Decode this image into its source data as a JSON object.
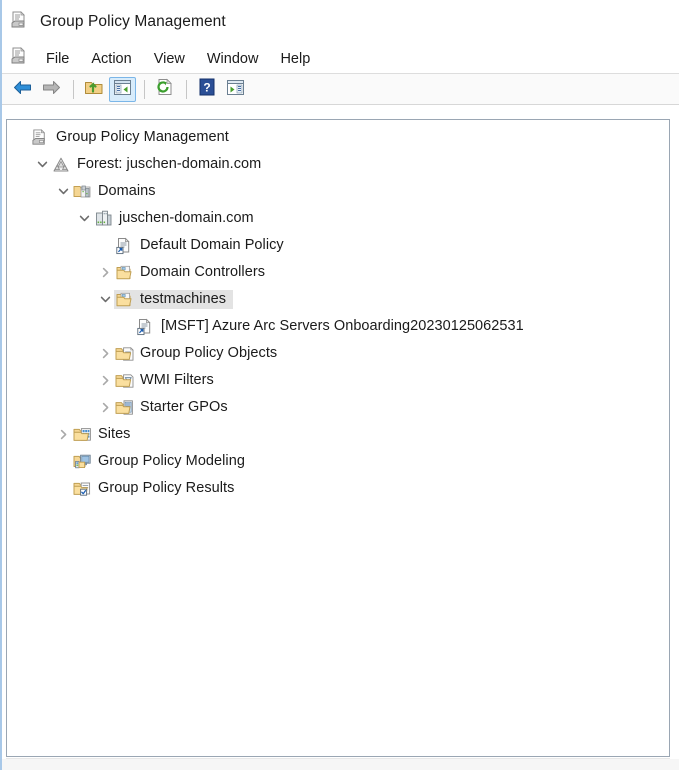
{
  "window": {
    "title": "Group Policy Management",
    "title_icon": "gpmc-console-icon"
  },
  "menubar": {
    "icon": "gpmc-console-icon",
    "items": [
      {
        "label": "File",
        "name": "menu-file"
      },
      {
        "label": "Action",
        "name": "menu-action"
      },
      {
        "label": "View",
        "name": "menu-view"
      },
      {
        "label": "Window",
        "name": "menu-window"
      },
      {
        "label": "Help",
        "name": "menu-help"
      }
    ]
  },
  "toolbar": {
    "buttons": [
      {
        "name": "back-button",
        "icon": "back-arrow-icon",
        "active": false
      },
      {
        "name": "forward-button",
        "icon": "forward-arrow-icon",
        "active": false
      },
      {
        "name": "up-one-level-button",
        "icon": "up-folder-icon",
        "active": false
      },
      {
        "name": "show-hide-console-tree-button",
        "icon": "console-tree-icon",
        "active": true
      },
      {
        "name": "refresh-button",
        "icon": "refresh-icon",
        "active": false
      },
      {
        "name": "help-button",
        "icon": "question-mark-icon",
        "active": false
      },
      {
        "name": "show-hide-action-pane-button",
        "icon": "action-pane-icon",
        "active": false
      }
    ]
  },
  "tree": {
    "nodes": [
      {
        "label": "Group Policy Management",
        "icon": "gpmc-console-icon",
        "twisty": "none",
        "indent": 0,
        "selected": false,
        "name": "tree-node-group-policy-management"
      },
      {
        "label": "Forest: juschen-domain.com",
        "icon": "forest-icon",
        "twisty": "expanded",
        "indent": 1,
        "selected": false,
        "name": "tree-node-forest"
      },
      {
        "label": "Domains",
        "icon": "domains-folder-icon",
        "twisty": "expanded",
        "indent": 2,
        "selected": false,
        "name": "tree-node-domains"
      },
      {
        "label": "juschen-domain.com",
        "icon": "domain-icon",
        "twisty": "expanded",
        "indent": 3,
        "selected": false,
        "name": "tree-node-domain-juschen"
      },
      {
        "label": "Default Domain Policy",
        "icon": "gpo-link-icon",
        "twisty": "none",
        "indent": 4,
        "selected": false,
        "name": "tree-node-default-domain-policy"
      },
      {
        "label": "Domain Controllers",
        "icon": "ou-icon",
        "twisty": "collapsed",
        "indent": 4,
        "selected": false,
        "name": "tree-node-domain-controllers"
      },
      {
        "label": "testmachines",
        "icon": "ou-icon",
        "twisty": "expanded",
        "indent": 4,
        "selected": true,
        "name": "tree-node-testmachines"
      },
      {
        "label": "[MSFT] Azure Arc Servers Onboarding20230125062531",
        "icon": "gpo-link-icon",
        "twisty": "none",
        "indent": 5,
        "selected": false,
        "name": "tree-node-azure-arc-gpo-link"
      },
      {
        "label": "Group Policy Objects",
        "icon": "gpo-container-icon",
        "twisty": "collapsed",
        "indent": 4,
        "selected": false,
        "name": "tree-node-group-policy-objects"
      },
      {
        "label": "WMI Filters",
        "icon": "wmi-filter-icon",
        "twisty": "collapsed",
        "indent": 4,
        "selected": false,
        "name": "tree-node-wmi-filters"
      },
      {
        "label": "Starter GPOs",
        "icon": "starter-gpo-icon",
        "twisty": "collapsed",
        "indent": 4,
        "selected": false,
        "name": "tree-node-starter-gpos"
      },
      {
        "label": "Sites",
        "icon": "sites-icon",
        "twisty": "collapsed",
        "indent": 2,
        "selected": false,
        "name": "tree-node-sites"
      },
      {
        "label": "Group Policy Modeling",
        "icon": "gp-modeling-icon",
        "twisty": "none",
        "indent": 2,
        "selected": false,
        "name": "tree-node-group-policy-modeling"
      },
      {
        "label": "Group Policy Results",
        "icon": "gp-results-icon",
        "twisty": "none",
        "indent": 2,
        "selected": false,
        "name": "tree-node-group-policy-results"
      }
    ]
  },
  "colors": {
    "selection": "#e3e3e3",
    "toolbar_active": "#d8ecfb",
    "folder": "#f3d08a",
    "accent_blue": "#2a5db0"
  }
}
